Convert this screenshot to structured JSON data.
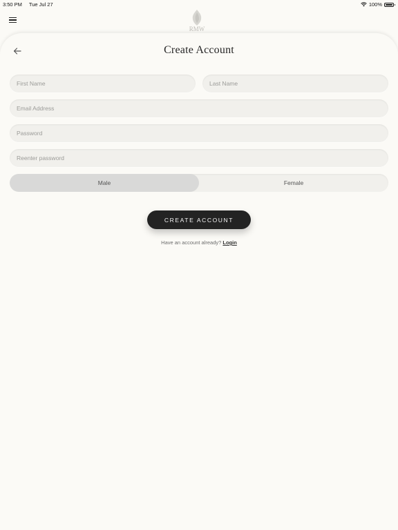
{
  "status_bar": {
    "time": "3:50 PM",
    "date": "Tue Jul 27",
    "battery": "100%"
  },
  "header": {
    "logo_text": "RMW",
    "title": "Create Account"
  },
  "form": {
    "first_name": {
      "placeholder": "First Name",
      "value": ""
    },
    "last_name": {
      "placeholder": "Last Name",
      "value": ""
    },
    "email": {
      "placeholder": "Email Address",
      "value": ""
    },
    "password": {
      "placeholder": "Password",
      "value": ""
    },
    "reenter_password": {
      "placeholder": "Reenter password",
      "value": ""
    },
    "gender": {
      "options": [
        "Male",
        "Female"
      ],
      "selected": "Male"
    },
    "submit_label": "CREATE ACCOUNT",
    "login_prompt": "Have an account already?",
    "login_link": "Login"
  },
  "colors": {
    "background": "#fbfaf6",
    "field": "#f1f0ec",
    "button": "#232323",
    "selected_toggle": "#d9d9d8"
  },
  "icons": {
    "menu": "hamburger-icon",
    "back": "arrow-left-icon",
    "wifi": "wifi-icon",
    "battery": "battery-icon"
  }
}
